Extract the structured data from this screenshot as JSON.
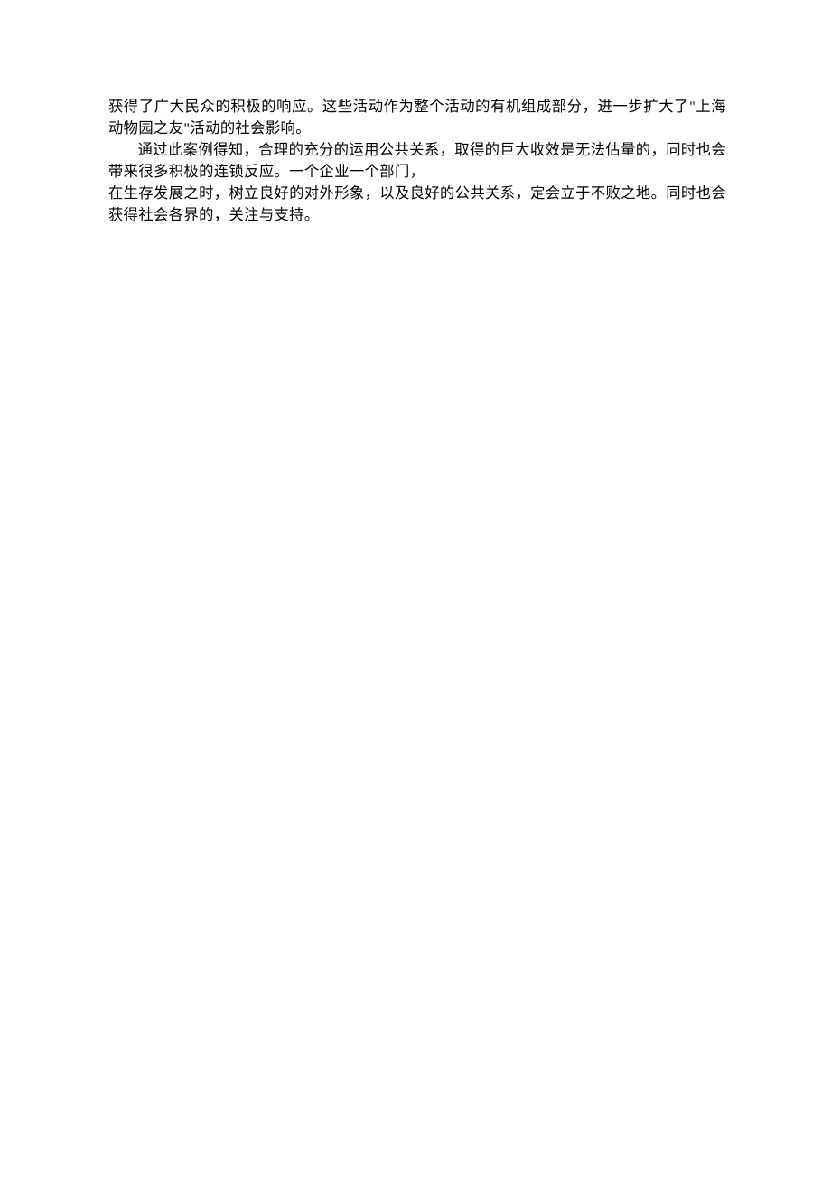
{
  "body": {
    "p1": "获得了广大民众的积极的响应。这些活动作为整个活动的有机组成部分，进一步扩大了\"上海动物园之友\"活动的社会影响。",
    "p2": "通过此案例得知，合理的充分的运用公共关系，取得的巨大收效是无法估量的，同时也会带来很多积极的连锁反应。一个企业一个部门，",
    "p3": "在生存发展之时，树立良好的对外形象，以及良好的公共关系，定会立于不败之地。同时也会获得社会各界的，关注与支持。"
  }
}
